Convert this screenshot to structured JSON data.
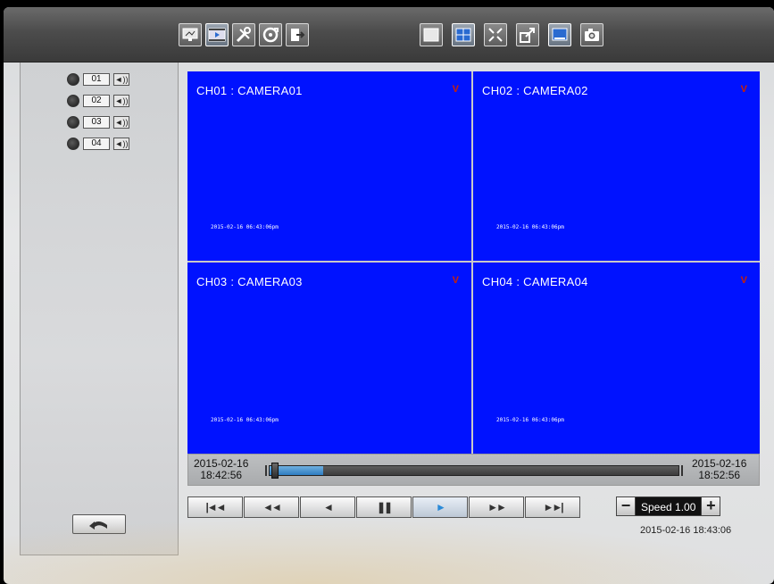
{
  "colors": {
    "video_bg": "#0012ff",
    "rec_indicator": "#cc2200",
    "timeline_fill": "#2d7cc0",
    "active_control": "#2a8ad8"
  },
  "toolbar": {
    "left_icons": [
      "monitor-icon",
      "playback-icon",
      "tools-icon",
      "backup-icon",
      "exit-icon"
    ],
    "right_icons": [
      "single-view-icon",
      "quad-view-icon",
      "fullscreen-icon",
      "restore-icon",
      "display-icon",
      "snapshot-icon"
    ]
  },
  "sidebar": {
    "channels": [
      {
        "num": "01",
        "audio": "◄))"
      },
      {
        "num": "02",
        "audio": "◄))"
      },
      {
        "num": "03",
        "audio": "◄))"
      },
      {
        "num": "04",
        "audio": "◄))"
      }
    ],
    "back_icon": "back-arrow-icon"
  },
  "video": {
    "tiles": [
      {
        "title": "CH01 : CAMERA01",
        "rec": "V",
        "osd": "2015-02-16 06:43:06pm"
      },
      {
        "title": "CH02 : CAMERA02",
        "rec": "V",
        "osd": "2015-02-16 06:43:06pm"
      },
      {
        "title": "CH03 : CAMERA03",
        "rec": "V",
        "osd": "2015-02-16 06:43:06pm"
      },
      {
        "title": "CH04 : CAMERA04",
        "rec": "V",
        "osd": "2015-02-16 06:43:06pm"
      }
    ]
  },
  "timeline": {
    "start_date": "2015-02-16",
    "start_time": "18:42:56",
    "end_date": "2015-02-16",
    "end_time": "18:52:56",
    "progress": 0.13
  },
  "playback": {
    "controls": [
      {
        "name": "skip-start-button",
        "glyph": "|◄◄",
        "active": false
      },
      {
        "name": "rewind-button",
        "glyph": "◄◄",
        "active": false
      },
      {
        "name": "reverse-play-button",
        "glyph": "◄",
        "active": false
      },
      {
        "name": "pause-button",
        "glyph": "❚❚",
        "active": false
      },
      {
        "name": "play-button",
        "glyph": "►",
        "active": true
      },
      {
        "name": "fast-forward-button",
        "glyph": "►►",
        "active": false
      },
      {
        "name": "skip-end-button",
        "glyph": "►►|",
        "active": false
      }
    ],
    "speed_minus": "−",
    "speed_label": "Speed 1.00",
    "speed_plus": "+",
    "current_time": "2015-02-16  18:43:06"
  }
}
